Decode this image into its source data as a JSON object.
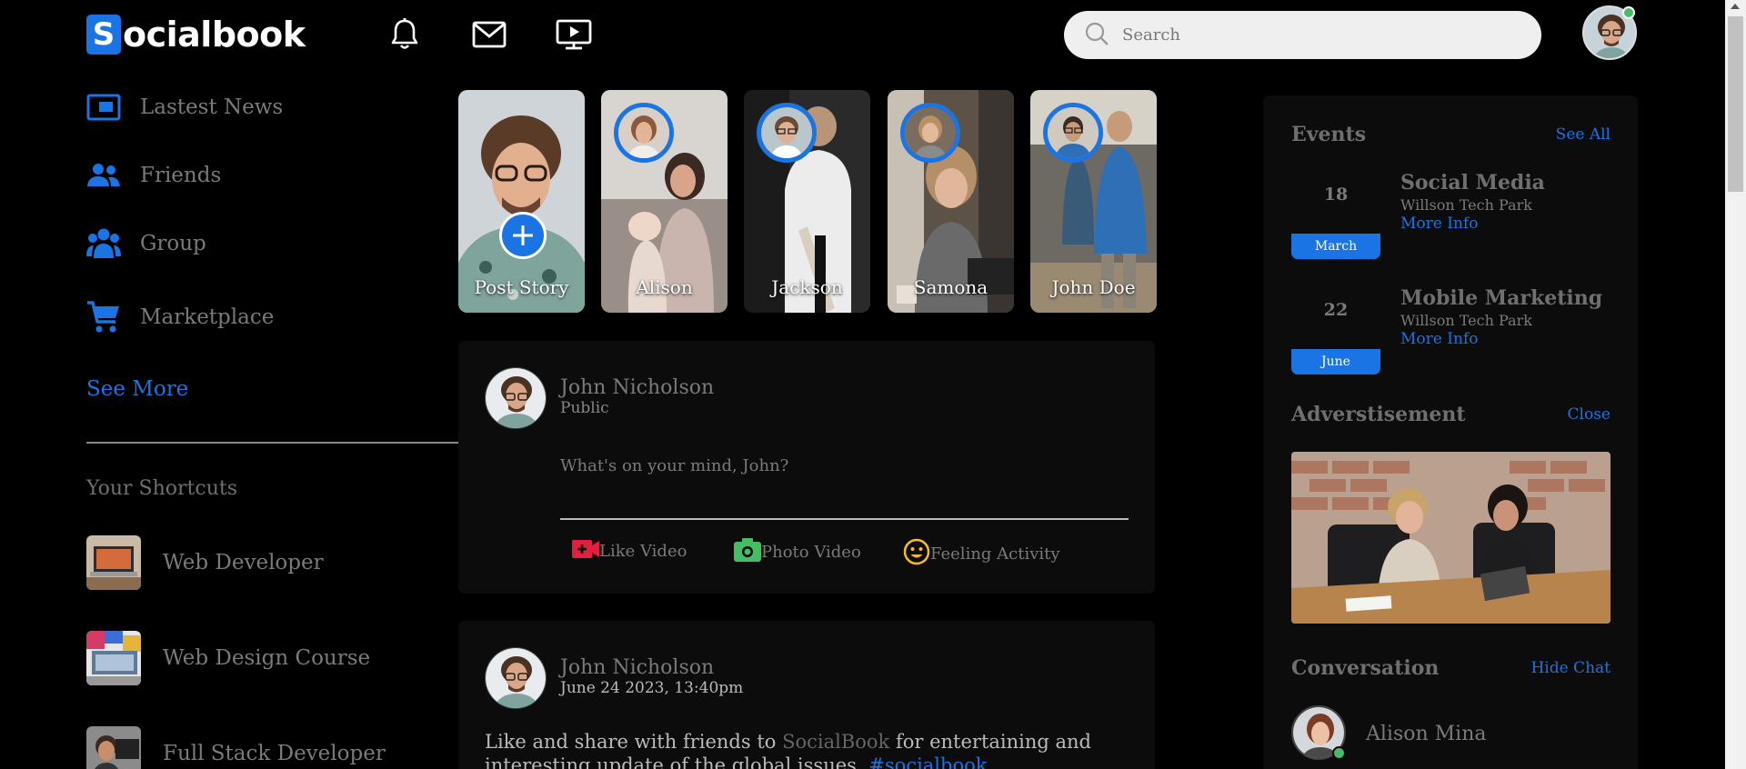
{
  "app": {
    "logo_letter": "S",
    "logo_text": "ocialbook",
    "brand_color": "#1b74e4"
  },
  "topbar": {
    "icons": [
      "bell-icon",
      "mail-icon",
      "video-icon"
    ],
    "search": {
      "placeholder": "Search",
      "value": ""
    },
    "user_online": true
  },
  "sidebar": {
    "items": [
      {
        "label": "Lastest News",
        "icon": "news-icon"
      },
      {
        "label": "Friends",
        "icon": "friends-icon"
      },
      {
        "label": "Group",
        "icon": "group-icon"
      },
      {
        "label": "Marketplace",
        "icon": "cart-icon"
      }
    ],
    "see_more": "See More",
    "shortcuts_title": "Your Shortcuts",
    "shortcuts": [
      {
        "label": "Web Developer"
      },
      {
        "label": "Web Design Course"
      },
      {
        "label": "Full Stack Developer"
      }
    ]
  },
  "stories": [
    {
      "label": "Post Story"
    },
    {
      "label": "Alison"
    },
    {
      "label": "Jackson"
    },
    {
      "label": "Samona"
    },
    {
      "label": "John Doe"
    }
  ],
  "composer": {
    "name": "John Nicholson",
    "visibility": "Public",
    "placeholder": "What's on your mind, John?",
    "actions": [
      {
        "label": "Like Video",
        "icon": "live-video-icon",
        "color": "#e41e3f"
      },
      {
        "label": "Photo Video",
        "icon": "camera-icon",
        "color": "#45bd62"
      },
      {
        "label": "Feeling Activity",
        "icon": "smile-icon",
        "color": "#f7b928"
      }
    ]
  },
  "post": {
    "name": "John Nicholson",
    "date": "June 24 2023, 13:40pm",
    "text_before": "Like and share with friends to ",
    "text_brand": "SocialBook",
    "text_after": " for entertaining and interesting update of the global issues. ",
    "hashtag": "#socialbook"
  },
  "right": {
    "events_title": "Events",
    "see_all": "See All",
    "events": [
      {
        "day": "18",
        "month": "March",
        "title": "Social Media",
        "place": "Willson Tech Park",
        "more": "More Info"
      },
      {
        "day": "22",
        "month": "June",
        "title": "Mobile Marketing",
        "place": "Willson Tech Park",
        "more": "More Info"
      }
    ],
    "ad_title": "Adverstisement",
    "ad_close": "Close",
    "conversation_title": "Conversation",
    "hide_chat": "Hide Chat",
    "contacts": [
      {
        "name": "Alison Mina",
        "online": true
      }
    ]
  }
}
